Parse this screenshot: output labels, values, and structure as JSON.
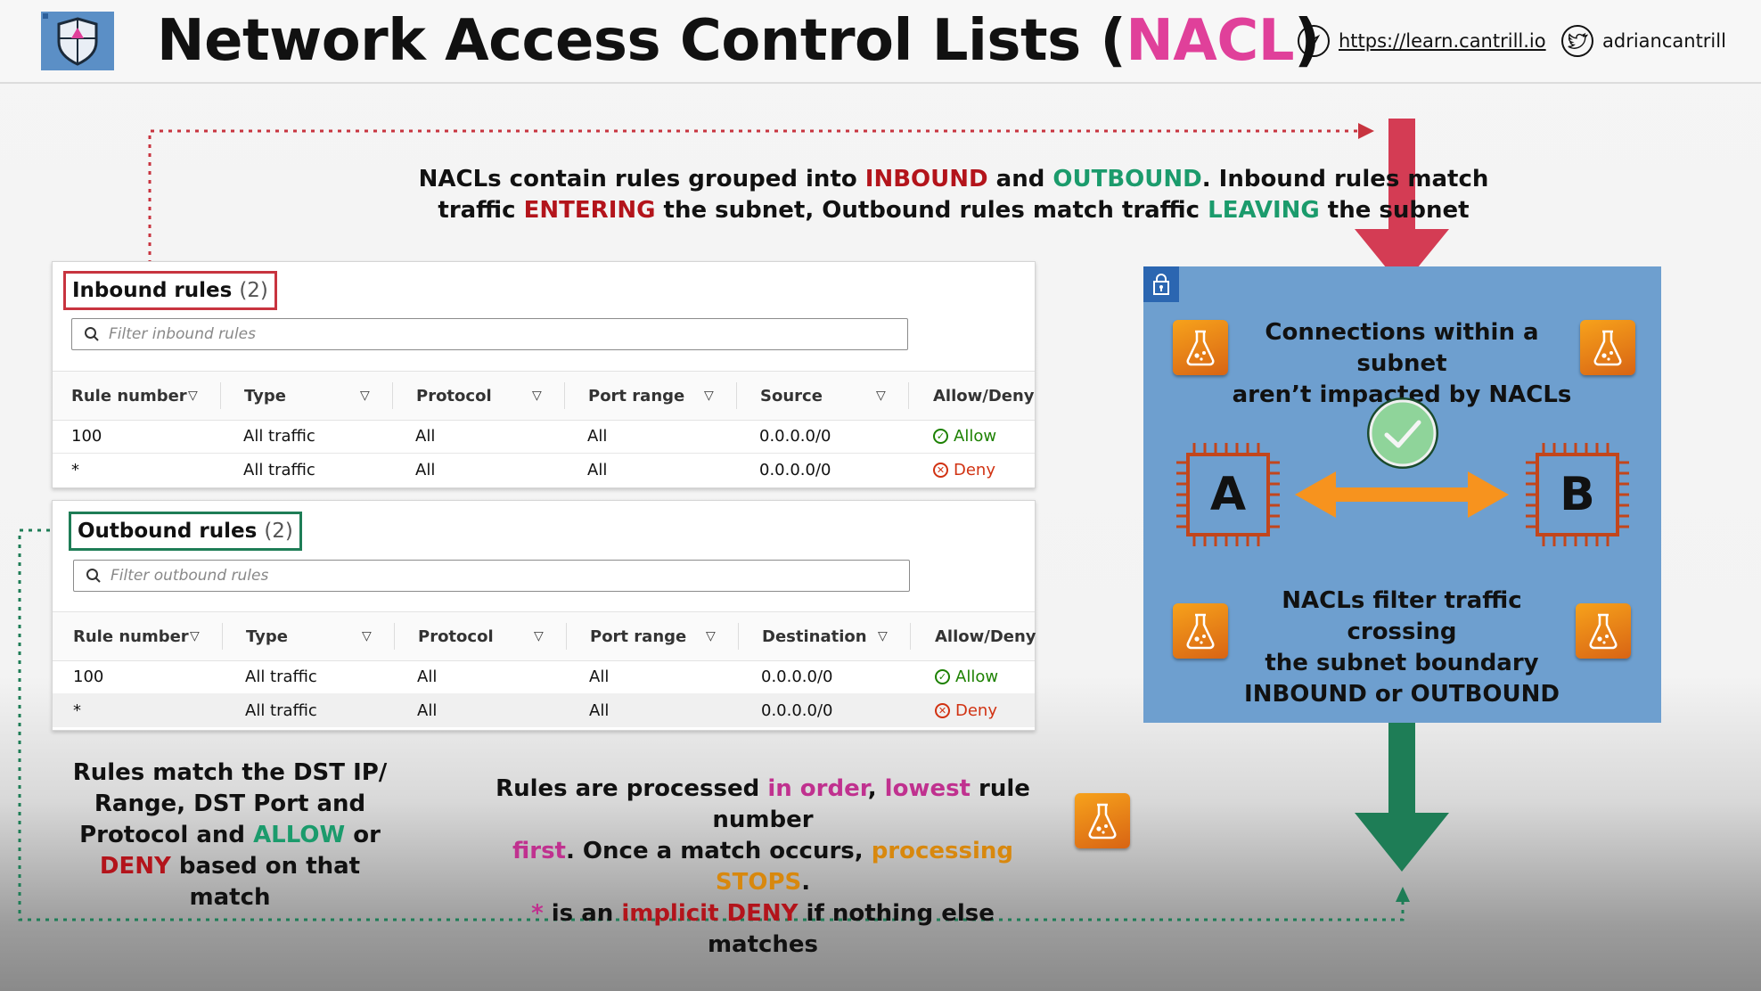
{
  "header": {
    "title_main": "Network Access Control Lists (",
    "title_accent": "NACL",
    "title_end": ")",
    "site_link": "https://learn.cantrill.io",
    "twitter_handle": "adriancantrill",
    "icons": [
      "shield-logo-icon",
      "compass-icon",
      "twitter-bird-icon"
    ]
  },
  "intro": {
    "p1": "NACLs contain rules grouped into ",
    "inbound": "INBOUND",
    "p2": " and ",
    "outbound": "OUTBOUND",
    "p3": ". Inbound rules match",
    "p4": "traffic ",
    "entering": "ENTERING",
    "p5": " the subnet, Outbound rules match traffic ",
    "leaving": "LEAVING",
    "p6": " the subnet"
  },
  "inbound": {
    "title": "Inbound rules",
    "count": "(2)",
    "filter_placeholder": "Filter inbound rules",
    "columns": [
      "Rule number",
      "Type",
      "Protocol",
      "Port range",
      "Source",
      "Allow/Deny"
    ],
    "rows": [
      {
        "rule": "100",
        "type": "All traffic",
        "protocol": "All",
        "port": "All",
        "addr": "0.0.0.0/0",
        "action": "Allow"
      },
      {
        "rule": "*",
        "type": "All traffic",
        "protocol": "All",
        "port": "All",
        "addr": "0.0.0.0/0",
        "action": "Deny"
      }
    ]
  },
  "outbound": {
    "title": "Outbound rules",
    "count": "(2)",
    "filter_placeholder": "Filter outbound rules",
    "columns": [
      "Rule number",
      "Type",
      "Protocol",
      "Port range",
      "Destination",
      "Allow/Deny"
    ],
    "rows": [
      {
        "rule": "100",
        "type": "All traffic",
        "protocol": "All",
        "port": "All",
        "addr": "0.0.0.0/0",
        "action": "Allow"
      },
      {
        "rule": "*",
        "type": "All traffic",
        "protocol": "All",
        "port": "All",
        "addr": "0.0.0.0/0",
        "action": "Deny"
      }
    ]
  },
  "subnet_box": {
    "top_l1": "Connections within a subnet",
    "top_l2": "aren’t impacted by NACLs",
    "node_a": "A",
    "node_b": "B",
    "bottom_l1": "NACLs filter traffic crossing",
    "bottom_l2": "the subnet boundary",
    "bottom_l3": "INBOUND or OUTBOUND"
  },
  "left_note": {
    "l1": "Rules match the DST IP/",
    "l2": "Range, DST Port and",
    "l3a": "Protocol and ",
    "l3b": "ALLOW",
    "l3c": " or",
    "l4a": "DENY",
    "l4b": " based on that match"
  },
  "center_note": {
    "a1": "Rules are processed ",
    "a2": "in order",
    "a3": ", ",
    "a4": "lowest",
    "a5": " rule number",
    "b1": "first",
    "b2": ". Once a match occurs, ",
    "b3": "processing STOPS",
    "b4": ".",
    "c1": "*",
    "c2": " is an ",
    "c3": "implicit DENY",
    "c4": " if nothing else matches"
  },
  "colors": {
    "accent_pink": "#e0409a",
    "inbound_red": "#c8343f",
    "outbound_green": "#1e7d56",
    "subnet_blue": "#6e9fcf",
    "arrow_orange": "#f7931e"
  }
}
